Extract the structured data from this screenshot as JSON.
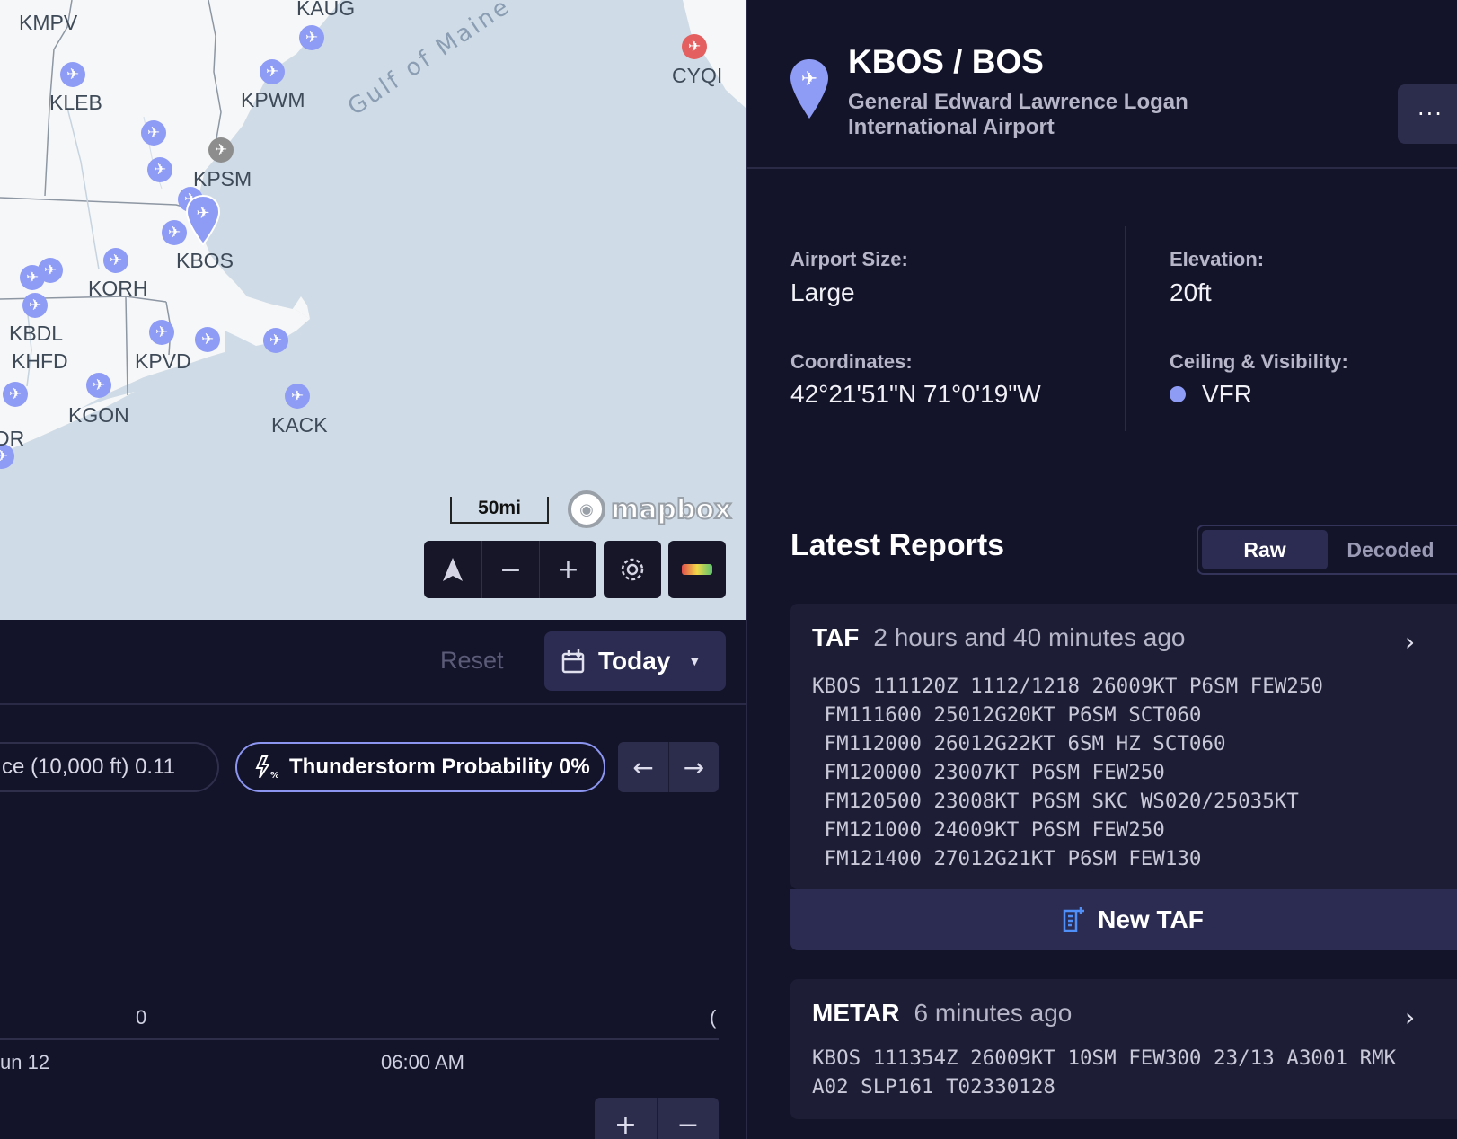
{
  "map": {
    "sea_label": "Gulf of Maine",
    "scale_label": "50mi",
    "attribution": "mapbox",
    "airports": [
      {
        "code": "KMPV",
        "status": "vfr"
      },
      {
        "code": "KAUG",
        "status": "vfr"
      },
      {
        "code": "CYQI",
        "status": "red"
      },
      {
        "code": "KLEB",
        "status": "vfr"
      },
      {
        "code": "KPWM",
        "status": "vfr"
      },
      {
        "code": "KPSM",
        "status": "grey"
      },
      {
        "code": "KBOS",
        "status": "vfr"
      },
      {
        "code": "KORH",
        "status": "vfr"
      },
      {
        "code": "KBDL",
        "status": "vfr"
      },
      {
        "code": "KHFD",
        "status": "vfr"
      },
      {
        "code": "KPVD",
        "status": "vfr"
      },
      {
        "code": "KGON",
        "status": "vfr"
      },
      {
        "code": "KACK",
        "status": "vfr"
      },
      {
        "code": "DR",
        "status": "vfr"
      }
    ],
    "controls": {
      "compass_icon": "navigation-arrow-icon",
      "zoom_out": "−",
      "zoom_in": "+",
      "settings_icon": "gear-icon",
      "legend_icon": "color-gradient-icon"
    }
  },
  "forecast": {
    "reset_label": "Reset",
    "date_selector": {
      "label": "Today",
      "icon": "calendar-icon"
    },
    "pills": [
      {
        "label": "ce (10,000 ft) 0.11"
      },
      {
        "label": "Thunderstorm Probability 0%",
        "icon": "lightning-icon",
        "active": true
      }
    ],
    "chart": {
      "values": [
        "0",
        "("
      ],
      "ticks": [
        "un 12",
        "06:00 AM"
      ]
    },
    "zoom": {
      "plus": "+",
      "minus": "−"
    }
  },
  "airport": {
    "title": "KBOS / BOS",
    "name": "General Edward Lawrence Logan International Airport",
    "more_label": "···",
    "size_label": "Airport Size:",
    "size_value": "Large",
    "elevation_label": "Elevation:",
    "elevation_value": "20ft",
    "coords_label": "Coordinates:",
    "coords_value": "42°21'51\"N 71°0'19\"W",
    "ceiling_label": "Ceiling & Visibility:",
    "ceiling_value": "VFR",
    "colors": {
      "vfr": "#8f9cf5",
      "accent": "#2c2c52"
    }
  },
  "reports": {
    "title": "Latest Reports",
    "tabs": [
      "Raw",
      "Decoded"
    ],
    "active_tab": "Raw",
    "taf": {
      "type": "TAF",
      "age": "2 hours and 40 minutes ago",
      "raw": "KBOS 111120Z 1112/1218 26009KT P6SM FEW250\n FM111600 25012G20KT P6SM SCT060\n FM112000 26012G22KT 6SM HZ SCT060\n FM120000 23007KT P6SM FEW250\n FM120500 23008KT P6SM SKC WS020/25035KT\n FM121000 24009KT P6SM FEW250\n FM121400 27012G21KT P6SM FEW130",
      "new_label": "New TAF"
    },
    "metar": {
      "type": "METAR",
      "age": "6 minutes ago",
      "raw": "KBOS 111354Z 26009KT 10SM FEW300 23/13 A3001 RMK\nA02 SLP161 T02330128"
    }
  }
}
